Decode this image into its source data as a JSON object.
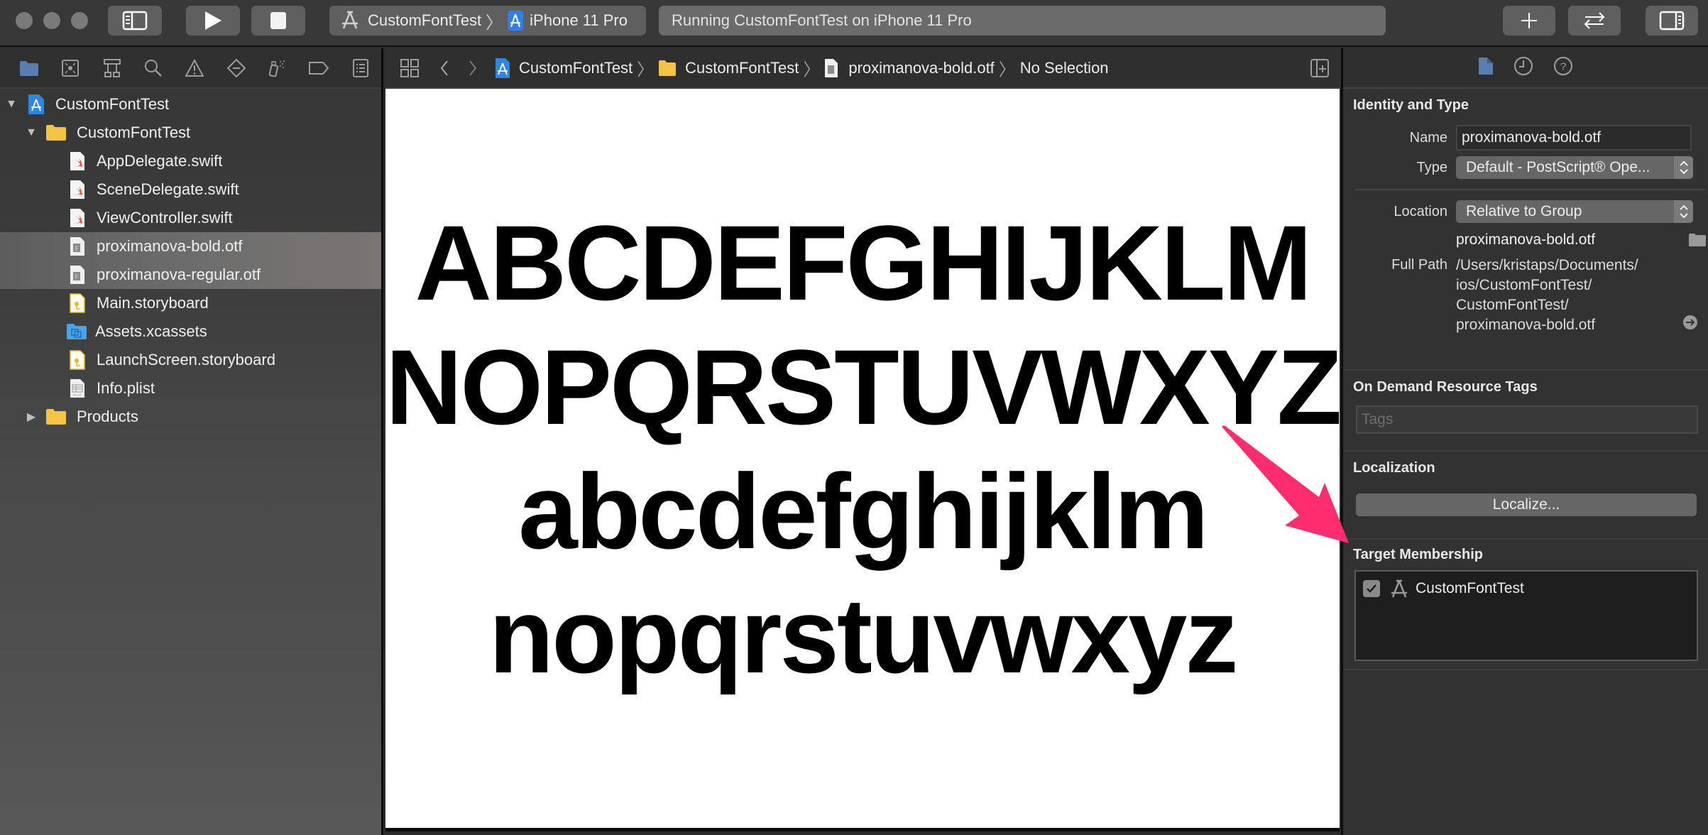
{
  "toolbar": {
    "scheme_target": "CustomFontTest",
    "scheme_device": "iPhone 11 Pro",
    "activity_status": "Running CustomFontTest on iPhone 11 Pro",
    "icons": {
      "navigator_toggle": "sidebar-left-icon",
      "run": "play-icon",
      "stop": "stop-icon",
      "library": "plus-icon",
      "code_review": "swap-arrows-icon",
      "inspector_toggle": "sidebar-right-icon"
    }
  },
  "navigator": {
    "tabs": [
      {
        "name": "project-navigator",
        "icon": "folder-icon",
        "active": true
      },
      {
        "name": "source-control-navigator",
        "icon": "source-control-icon",
        "active": false
      },
      {
        "name": "symbol-navigator",
        "icon": "hierarchy-icon",
        "active": false
      },
      {
        "name": "find-navigator",
        "icon": "search-icon",
        "active": false
      },
      {
        "name": "issue-navigator",
        "icon": "warning-icon",
        "active": false
      },
      {
        "name": "test-navigator",
        "icon": "diamond-minus-icon",
        "active": false
      },
      {
        "name": "debug-navigator",
        "icon": "spray-icon",
        "active": false
      },
      {
        "name": "breakpoint-navigator",
        "icon": "tag-icon",
        "active": false
      },
      {
        "name": "report-navigator",
        "icon": "list-icon",
        "active": false
      }
    ],
    "tree": [
      {
        "label": "CustomFontTest",
        "type": "project",
        "level": 0,
        "disclosure": "expanded"
      },
      {
        "label": "CustomFontTest",
        "type": "folder",
        "level": 1,
        "disclosure": "expanded"
      },
      {
        "label": "AppDelegate.swift",
        "type": "swift",
        "level": 2
      },
      {
        "label": "SceneDelegate.swift",
        "type": "swift",
        "level": 2
      },
      {
        "label": "ViewController.swift",
        "type": "swift",
        "level": 2
      },
      {
        "label": "proximanova-bold.otf",
        "type": "font",
        "level": 2,
        "selected": true
      },
      {
        "label": "proximanova-regular.otf",
        "type": "font",
        "level": 2,
        "selected": true
      },
      {
        "label": "Main.storyboard",
        "type": "storyboard",
        "level": 2
      },
      {
        "label": "Assets.xcassets",
        "type": "assets",
        "level": 2
      },
      {
        "label": "LaunchScreen.storyboard",
        "type": "storyboard",
        "level": 2
      },
      {
        "label": "Info.plist",
        "type": "plist",
        "level": 2
      },
      {
        "label": "Products",
        "type": "folder",
        "level": 1,
        "disclosure": "collapsed"
      }
    ]
  },
  "editor": {
    "breadcrumb": [
      {
        "label": "CustomFontTest",
        "icon": "project-icon"
      },
      {
        "label": "CustomFontTest",
        "icon": "folder-icon"
      },
      {
        "label": "proximanova-bold.otf",
        "icon": "font-file-icon"
      },
      {
        "label": "No Selection",
        "icon": ""
      }
    ],
    "preview_lines": [
      "ABCDEFGHIJKLM",
      "NOPQRSTUVWXYZ",
      "abcdefghijklm",
      "nopqrstuvwxyz"
    ]
  },
  "inspector": {
    "tabs": [
      {
        "name": "file-inspector",
        "icon": "document-icon",
        "active": true
      },
      {
        "name": "history-inspector",
        "icon": "clock-icon",
        "active": false
      },
      {
        "name": "quick-help-inspector",
        "icon": "question-icon",
        "active": false
      }
    ],
    "identity": {
      "title": "Identity and Type",
      "name_label": "Name",
      "name_value": "proximanova-bold.otf",
      "type_label": "Type",
      "type_value": "Default - PostScript® Ope...",
      "location_label": "Location",
      "location_value": "Relative to Group",
      "location_file": "proximanova-bold.otf",
      "full_path_label": "Full Path",
      "full_path_lines": [
        "/Users/kristaps/Documents/",
        "ios/CustomFontTest/",
        "CustomFontTest/",
        "proximanova-bold.otf"
      ]
    },
    "resource_tags": {
      "title": "On Demand Resource Tags",
      "placeholder": "Tags"
    },
    "localization": {
      "title": "Localization",
      "button": "Localize..."
    },
    "target_membership": {
      "title": "Target Membership",
      "targets": [
        {
          "label": "CustomFontTest",
          "checked": true
        }
      ]
    }
  },
  "annotation": {
    "arrow_color": "#ff2d6f"
  }
}
